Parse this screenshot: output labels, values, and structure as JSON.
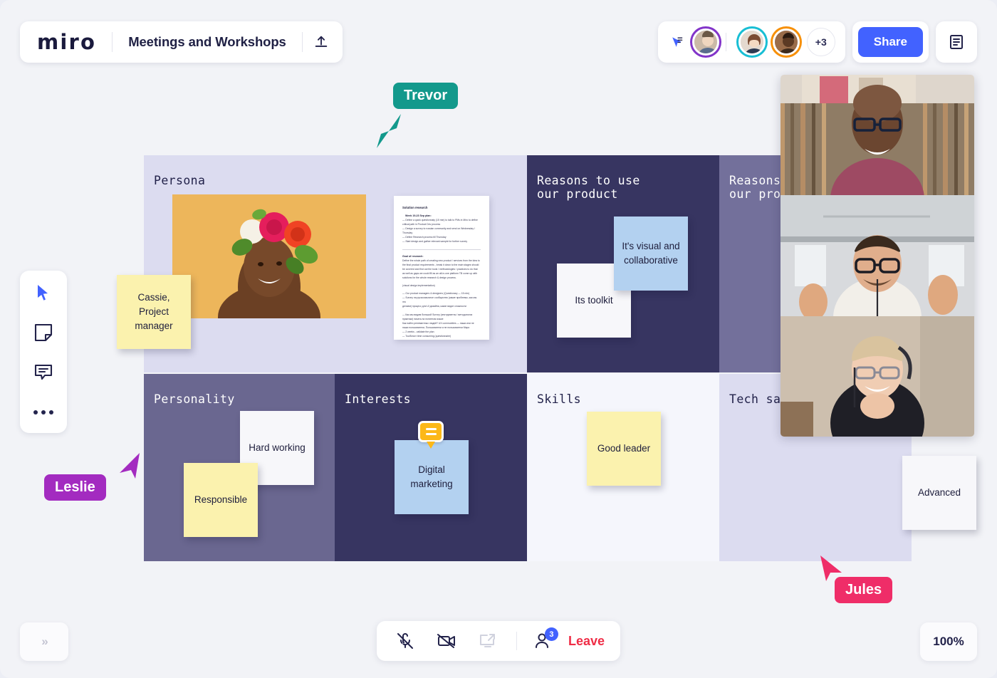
{
  "header": {
    "logo": "miro",
    "board_title": "Meetings and Workshops",
    "upload_icon": "upload-icon",
    "follow_icon": "follow-cursor-icon",
    "avatars": [
      {
        "name": "avatar-1",
        "ring": "#8234c9"
      },
      {
        "name": "avatar-2",
        "ring": "#18bed4"
      },
      {
        "name": "avatar-3",
        "ring": "#f79009"
      }
    ],
    "more_avatars": "+3",
    "share_label": "Share",
    "notes_icon": "notes-panel-icon",
    "accent": "#4262ff"
  },
  "toolrail": {
    "items": [
      {
        "icon": "cursor-select-icon",
        "active": true
      },
      {
        "icon": "sticky-note-icon",
        "active": false
      },
      {
        "icon": "comment-icon",
        "active": false
      },
      {
        "icon": "more-options-icon",
        "active": false
      }
    ]
  },
  "board": {
    "cells": [
      {
        "title": "Persona",
        "bg": "#dcdcf0"
      },
      {
        "title": "Reasons to use\nour product",
        "bg": "#373561"
      },
      {
        "title": "Reasons to use\nour product",
        "bg": "#73709b"
      },
      {
        "title": "Personality",
        "bg": "#6a6790"
      },
      {
        "title": "Interests",
        "bg": "#373561"
      },
      {
        "title": "Skills",
        "bg": "#f5f6fc"
      },
      {
        "title": "Tech savvy",
        "bg": "#dcdcf0"
      }
    ],
    "titles": {
      "persona": "Persona",
      "reasons_1_line1": "Reasons to use",
      "reasons_1_line2": "our product",
      "reasons_2_line1": "Reasons to use",
      "reasons_2_line2": "our product",
      "personality": "Personality",
      "interests": "Interests",
      "skills": "Skills",
      "tech": "Tech savvy"
    },
    "notes": {
      "cassie": "Cassie, Project manager",
      "its_toolkit": "Its toolkit",
      "visual_collaborative": "It's visual and collaborative",
      "hard_working": "Hard working",
      "responsible": "Responsible",
      "digital_marketing": "Digital marketing",
      "good_leader": "Good leader",
      "advanced": "Advanced"
    },
    "document": {
      "heading": "Solution research",
      "sub1": "Week 19-23 Sep plan:",
      "lines1": [
        "— Define a quick questionnaty (15 min) to talk to PMs in Miro to define",
        "critical path in Product Dev process",
        "— Design a survey to russian community and send on Wednesday /",
        "Thursday",
        "— Define Research process till Thursday",
        "— Start design and gather relevant sample for further survey"
      ],
      "sub2": "Goal of research:",
      "lines2": [
        "Define the whole path of creating new product / services from the idea to",
        "the final product requirements , break it down to the main stages should",
        "be covered and find out the tools / methodologies / practices to do that",
        "as well as gaps we could fill as an all-in-one platform TB come up with",
        "solutions for the whole research & design process."
      ],
      "sub3": "(visual design implementation)",
      "lines3": [
        "— Our product managers & designers (Questionary — 15 min)",
        "— Survey на русскоязычное сообщество (какие проблемы, как мы это",
        "делаем) процесс для UI дизайна, какие видят сложности",
        "",
        "— Как мы видим большой Survey (инструменты / методологии",
        "практики) писать на понятном языке",
        "Как найти релевантных людей? UX communities — наши или не",
        "наши пользователи, Пользователи и не пользователи Миро",
        "— 2 weeks - validate the plan",
        "— Too/Бесит time consuming (questionnaire)"
      ]
    }
  },
  "cursors": [
    {
      "name": "Trevor",
      "color": "#13998c"
    },
    {
      "name": "Leslie",
      "color": "#a32bc0"
    },
    {
      "name": "Jules",
      "color": "#ef2d68"
    }
  ],
  "video_panel": {
    "tiles": [
      "participant-video-1",
      "participant-video-2",
      "participant-video-3"
    ]
  },
  "bottom": {
    "expand_label": "»",
    "zoom_level": "100%",
    "mic_icon": "microphone-muted-icon",
    "camera_icon": "camera-muted-icon",
    "screen_share_icon": "screen-share-icon",
    "people_icon": "participants-icon",
    "people_count": "3",
    "leave_label": "Leave",
    "leave_color": "#ef2d46"
  }
}
